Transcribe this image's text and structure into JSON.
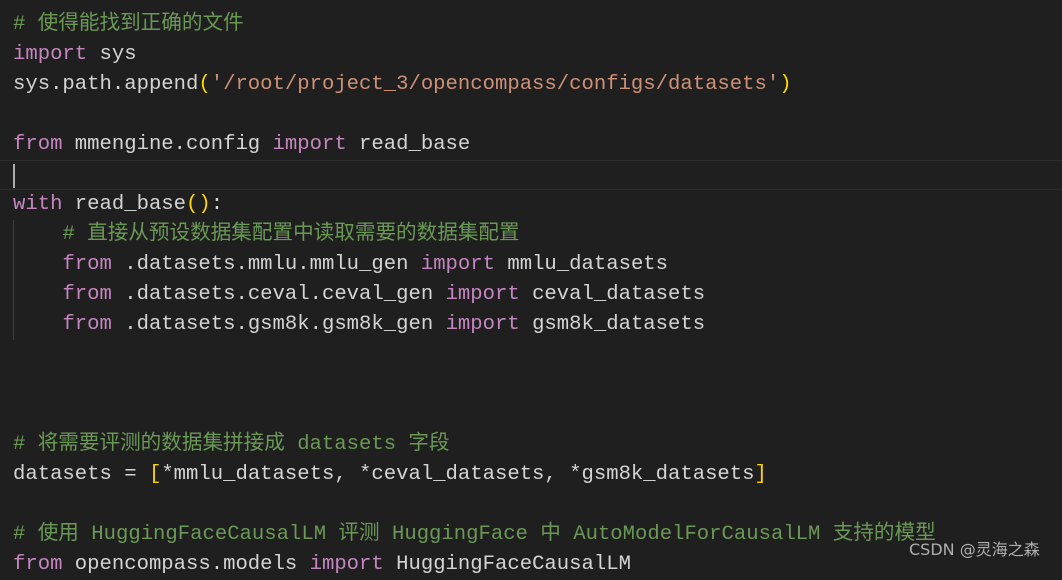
{
  "editor": {
    "current_line": 5,
    "lines": [
      [
        {
          "t": "# 使得能找到正确的文件",
          "c": "cm"
        }
      ],
      [
        {
          "t": "import",
          "c": "kw"
        },
        {
          "t": " sys",
          "c": "tx"
        }
      ],
      [
        {
          "t": "sys.path.append",
          "c": "tx"
        },
        {
          "t": "(",
          "c": "br"
        },
        {
          "t": "'/root/project_3/opencompass/configs/datasets'",
          "c": "st"
        },
        {
          "t": ")",
          "c": "br"
        }
      ],
      [],
      [
        {
          "t": "from",
          "c": "kw"
        },
        {
          "t": " mmengine.config ",
          "c": "tx"
        },
        {
          "t": "import",
          "c": "kw"
        },
        {
          "t": " read_base",
          "c": "tx"
        }
      ],
      [],
      [
        {
          "t": "with",
          "c": "kw"
        },
        {
          "t": " read_base",
          "c": "tx"
        },
        {
          "t": "()",
          "c": "br"
        },
        {
          "t": ":",
          "c": "tx"
        }
      ],
      [
        {
          "t": "    ",
          "c": "tx"
        },
        {
          "t": "# 直接从预设数据集配置中读取需要的数据集配置",
          "c": "cm"
        }
      ],
      [
        {
          "t": "    ",
          "c": "tx"
        },
        {
          "t": "from",
          "c": "kw"
        },
        {
          "t": " .datasets.mmlu.mmlu_gen ",
          "c": "tx"
        },
        {
          "t": "import",
          "c": "kw"
        },
        {
          "t": " mmlu_datasets",
          "c": "tx"
        }
      ],
      [
        {
          "t": "    ",
          "c": "tx"
        },
        {
          "t": "from",
          "c": "kw"
        },
        {
          "t": " .datasets.ceval.ceval_gen ",
          "c": "tx"
        },
        {
          "t": "import",
          "c": "kw"
        },
        {
          "t": " ceval_datasets",
          "c": "tx"
        }
      ],
      [
        {
          "t": "    ",
          "c": "tx"
        },
        {
          "t": "from",
          "c": "kw"
        },
        {
          "t": " .datasets.gsm8k.gsm8k_gen ",
          "c": "tx"
        },
        {
          "t": "import",
          "c": "kw"
        },
        {
          "t": " gsm8k_datasets",
          "c": "tx"
        }
      ],
      [],
      [],
      [],
      [
        {
          "t": "# 将需要评测的数据集拼接成 datasets 字段",
          "c": "cm"
        }
      ],
      [
        {
          "t": "datasets = ",
          "c": "tx"
        },
        {
          "t": "[",
          "c": "br"
        },
        {
          "t": "*mmlu_datasets, *ceval_datasets, *gsm8k_datasets",
          "c": "tx"
        },
        {
          "t": "]",
          "c": "br"
        }
      ],
      [],
      [
        {
          "t": "# 使用 HuggingFaceCausalLM 评测 HuggingFace 中 AutoModelForCausalLM 支持的模型",
          "c": "cm"
        }
      ],
      [
        {
          "t": "from",
          "c": "kw"
        },
        {
          "t": " opencompass.models ",
          "c": "tx"
        },
        {
          "t": "import",
          "c": "kw"
        },
        {
          "t": " HuggingFaceCausalLM",
          "c": "tx"
        }
      ]
    ],
    "indent_guide_lines": [
      7,
      8,
      9,
      10
    ]
  },
  "watermark": "CSDN @灵海之森"
}
